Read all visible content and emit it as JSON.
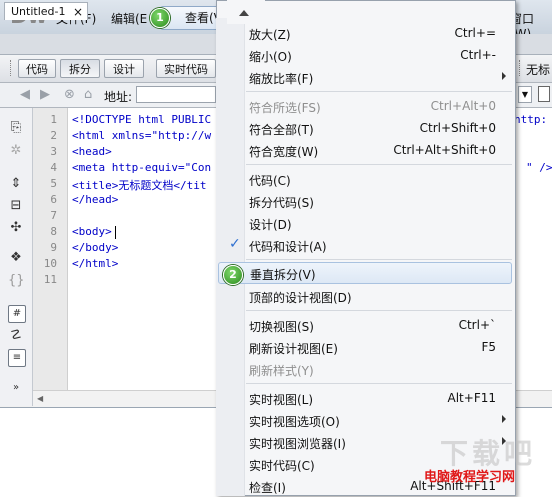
{
  "app": {
    "logo": "Dw"
  },
  "menubar": {
    "items": [
      {
        "label": "文件(F)"
      },
      {
        "label": "编辑(E"
      },
      {
        "label": "查看(V)"
      },
      {
        "label": "窗口(W)"
      }
    ],
    "step1": "1"
  },
  "tabs": {
    "doc": "Untitled-1",
    "close": "×"
  },
  "toolbar": {
    "code": "代码",
    "split": "拆分",
    "design": "设计",
    "live_code": "实时代码",
    "right_label": "无标"
  },
  "addressbar": {
    "label": "地址:"
  },
  "code": {
    "line_numbers": [
      "1",
      "2",
      "3",
      "4",
      "5",
      "6",
      "7",
      "8",
      "9",
      "10",
      "11"
    ],
    "lines": [
      "<!DOCTYPE html PUBLIC",
      "<html xmlns=\"http://w",
      "<head>",
      "<meta http-equiv=\"Con",
      "<title>无标题文档</tit",
      "</head>",
      "",
      "<body>",
      "</body>",
      "</html>",
      ""
    ],
    "right_frag1": "http:",
    "right_frag2": "\" />"
  },
  "view_menu": {
    "step2": "2",
    "groups": [
      [
        {
          "label": "放大(Z)",
          "shortcut": "Ctrl+=",
          "disabled": false
        },
        {
          "label": "缩小(O)",
          "shortcut": "Ctrl+-",
          "disabled": false
        },
        {
          "label": "缩放比率(F)",
          "shortcut": "",
          "submenu": true,
          "disabled": false
        }
      ],
      [
        {
          "label": "符合所选(FS)",
          "shortcut": "Ctrl+Alt+0",
          "disabled": true
        },
        {
          "label": "符合全部(T)",
          "shortcut": "Ctrl+Shift+0",
          "disabled": false
        },
        {
          "label": "符合宽度(W)",
          "shortcut": "Ctrl+Alt+Shift+0",
          "disabled": false
        }
      ],
      [
        {
          "label": "代码(C)",
          "shortcut": "",
          "disabled": false
        },
        {
          "label": "拆分代码(S)",
          "shortcut": "",
          "disabled": false
        },
        {
          "label": "设计(D)",
          "shortcut": "",
          "disabled": false
        },
        {
          "label": "代码和设计(A)",
          "shortcut": "",
          "checked": true,
          "disabled": false
        }
      ],
      [
        {
          "label": "垂直拆分(V)",
          "shortcut": "",
          "highlighted": true,
          "disabled": false
        },
        {
          "label": "顶部的设计视图(D)",
          "shortcut": "",
          "disabled": false
        }
      ],
      [
        {
          "label": "切换视图(S)",
          "shortcut": "Ctrl+`",
          "disabled": false
        },
        {
          "label": "刷新设计视图(E)",
          "shortcut": "F5",
          "disabled": false
        },
        {
          "label": "刷新样式(Y)",
          "shortcut": "",
          "disabled": true
        }
      ],
      [
        {
          "label": "实时视图(L)",
          "shortcut": "Alt+F11",
          "disabled": false
        },
        {
          "label": "实时视图选项(O)",
          "shortcut": "",
          "submenu": true,
          "disabled": false
        },
        {
          "label": "实时视图浏览器(I)",
          "shortcut": "",
          "submenu": true,
          "disabled": false
        },
        {
          "label": "实时代码(C)",
          "shortcut": "",
          "disabled": false
        },
        {
          "label": "检查(I)",
          "shortcut": "Alt+Shift+F11",
          "disabled": false
        }
      ]
    ]
  },
  "watermark": {
    "top": "下载吧",
    "bottom": "电脑教程学习网"
  }
}
